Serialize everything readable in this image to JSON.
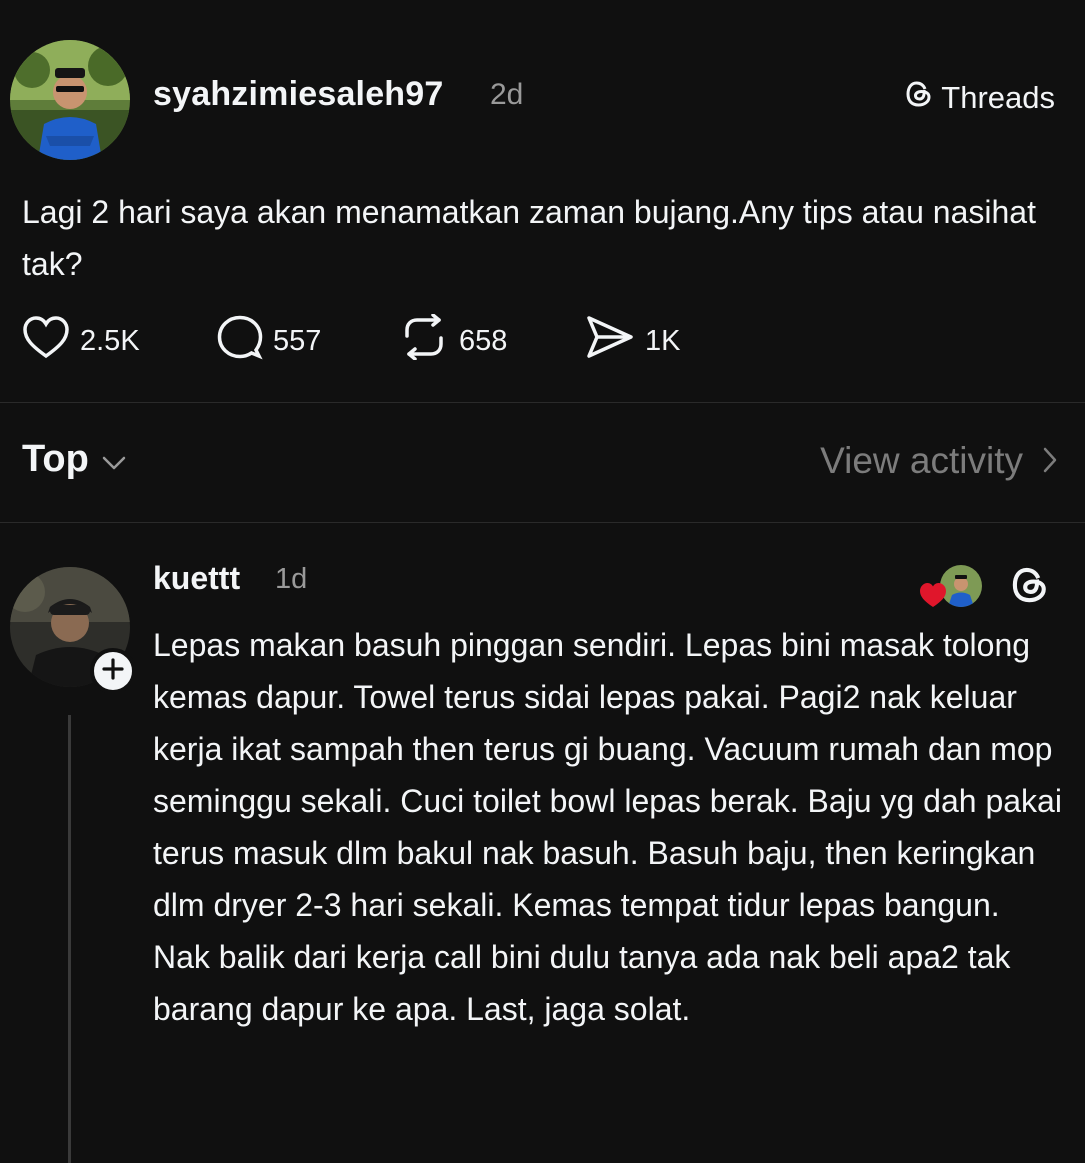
{
  "post": {
    "username": "syahzimiesaleh97",
    "time": "2d",
    "brand": "Threads",
    "text": "Lagi 2 hari saya akan menamatkan zaman bujang.Any tips atau nasihat tak?",
    "likes": "2.5K",
    "comments": "557",
    "reposts": "658",
    "shares": "1K"
  },
  "sort": {
    "label": "Top",
    "view_activity": "View activity"
  },
  "reply": {
    "username": "kuettt",
    "time": "1d",
    "text": "Lepas makan basuh pinggan sendiri. Lepas bini masak tolong kemas dapur. Towel terus sidai lepas pakai. Pagi2 nak keluar kerja ikat sampah then terus gi buang. Vacuum rumah dan mop seminggu sekali. Cuci toilet bowl lepas berak. Baju yg dah pakai terus masuk dlm bakul nak basuh. Basuh baju, then keringkan dlm dryer 2-3 hari sekali. Kemas tempat tidur lepas bangun. Nak balik dari kerja call bini dulu tanya ada nak beli apa2 tak barang dapur ke apa. Last, jaga solat."
  },
  "colors": {
    "background": "#101010",
    "text": "#f3f5f7",
    "muted": "#9a9a9a",
    "heart": "#e0162b"
  },
  "icons": [
    "heart-icon",
    "comment-icon",
    "repost-icon",
    "share-icon",
    "threads-logo-icon",
    "chevron-down-icon",
    "chevron-right-icon",
    "plus-icon",
    "liked-heart-icon"
  ]
}
